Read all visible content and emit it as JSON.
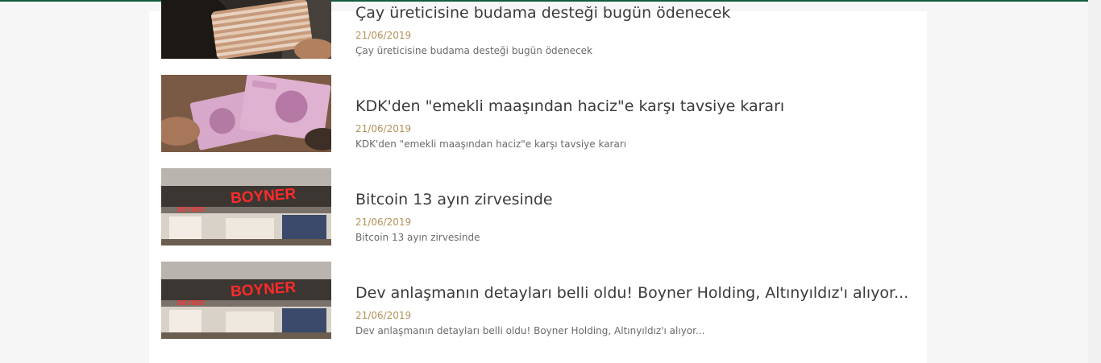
{
  "news": [
    {
      "title": "Çay üreticisine budama desteği bugün ödenecek",
      "date": "21/06/2019",
      "summary": "Çay üreticisine budama desteği bugün ödenecek",
      "image_alt": "money-stack-image"
    },
    {
      "title": "KDK'den \"emekli maaşından haciz\"e karşı tavsiye kararı",
      "date": "21/06/2019",
      "summary": "KDK'den \"emekli maaşından haciz\"e karşı tavsiye kararı",
      "image_alt": "banknotes-in-hand-image"
    },
    {
      "title": "Bitcoin 13 ayın zirvesinde",
      "date": "21/06/2019",
      "summary": "Bitcoin 13 ayın zirvesinde",
      "image_alt": "boyner-store-image"
    },
    {
      "title": "Dev anlaşmanın detayları belli oldu! Boyner Holding, Altınyıldız'ı alıyor...",
      "date": "21/06/2019",
      "summary": "Dev anlaşmanın detayları belli oldu! Boyner Holding, Altınyıldız'ı alıyor...",
      "image_alt": "boyner-store-image"
    }
  ],
  "store_sign": "BOYNER",
  "store_sign_small": "BOYNER",
  "colors": {
    "accent": "#0f5e3e",
    "date": "#b3925a",
    "title": "#3b3b3b"
  }
}
